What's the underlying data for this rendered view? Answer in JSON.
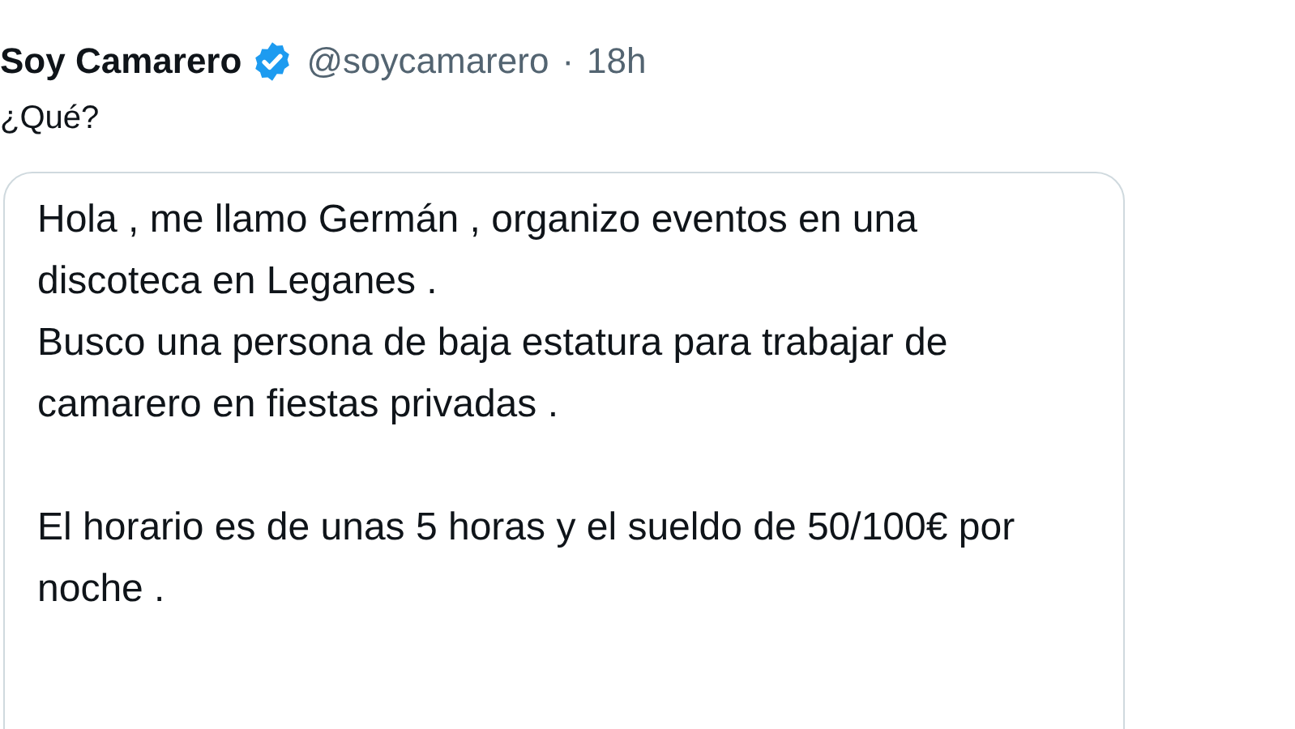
{
  "tweet": {
    "author": "Soy Camarero",
    "verified": true,
    "handle": "@soycamarero",
    "separator": "·",
    "time": "18h",
    "text": "¿Qué?",
    "quoted_message": {
      "paragraphs": [
        "Hola , me llamo Germán , organizo eventos en una discoteca en Leganes .\nBusco una persona de baja estatura para trabajar de camarero en fiestas privadas .",
        "El horario es de unas 5 horas y el sueldo de 50/100€ por noche ."
      ]
    }
  }
}
